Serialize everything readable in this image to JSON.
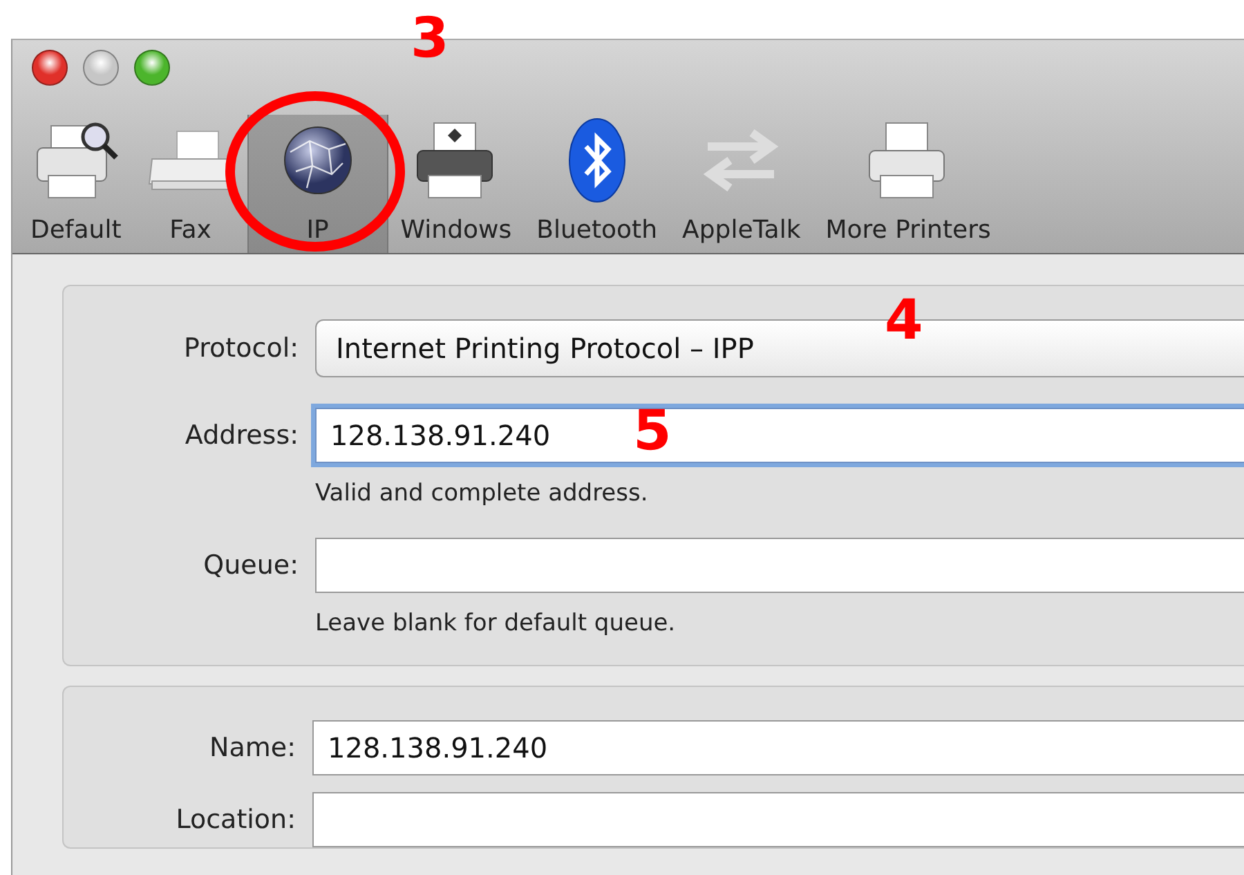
{
  "window": {
    "controls": [
      {
        "kind": "close"
      },
      {
        "kind": "minimize"
      },
      {
        "kind": "zoom"
      }
    ]
  },
  "toolbar": [
    {
      "kind": "printer-search",
      "label": "Default",
      "selected": false
    },
    {
      "kind": "fax",
      "label": "Fax",
      "selected": false
    },
    {
      "kind": "globe",
      "label": "IP",
      "selected": true
    },
    {
      "kind": "printer-windows",
      "label": "Windows",
      "selected": false
    },
    {
      "kind": "bluetooth",
      "label": "Bluetooth",
      "selected": false
    },
    {
      "kind": "arrows",
      "label": "AppleTalk",
      "selected": false
    },
    {
      "kind": "printer",
      "label": "More Printers",
      "selected": false
    }
  ],
  "connection": {
    "rows": [
      {
        "kind": "popup",
        "label": "Protocol:",
        "value": "Internet Printing Protocol – IPP"
      },
      {
        "kind": "field",
        "label": "Address:",
        "value": "128.138.91.240",
        "focused": true,
        "hint": "Valid and complete address."
      },
      {
        "kind": "field",
        "label": "Queue:",
        "value": "",
        "focused": false,
        "hint": "Leave blank for default queue."
      }
    ]
  },
  "details": {
    "rows": [
      {
        "kind": "field",
        "label": "Name:",
        "value": "128.138.91.240",
        "focused": false
      },
      {
        "kind": "field",
        "label": "Location:",
        "value": "",
        "focused": false
      }
    ]
  },
  "annotations": [
    {
      "kind": "number",
      "text": "3"
    },
    {
      "kind": "circle"
    },
    {
      "kind": "number",
      "text": "4"
    },
    {
      "kind": "number",
      "text": "5"
    }
  ]
}
